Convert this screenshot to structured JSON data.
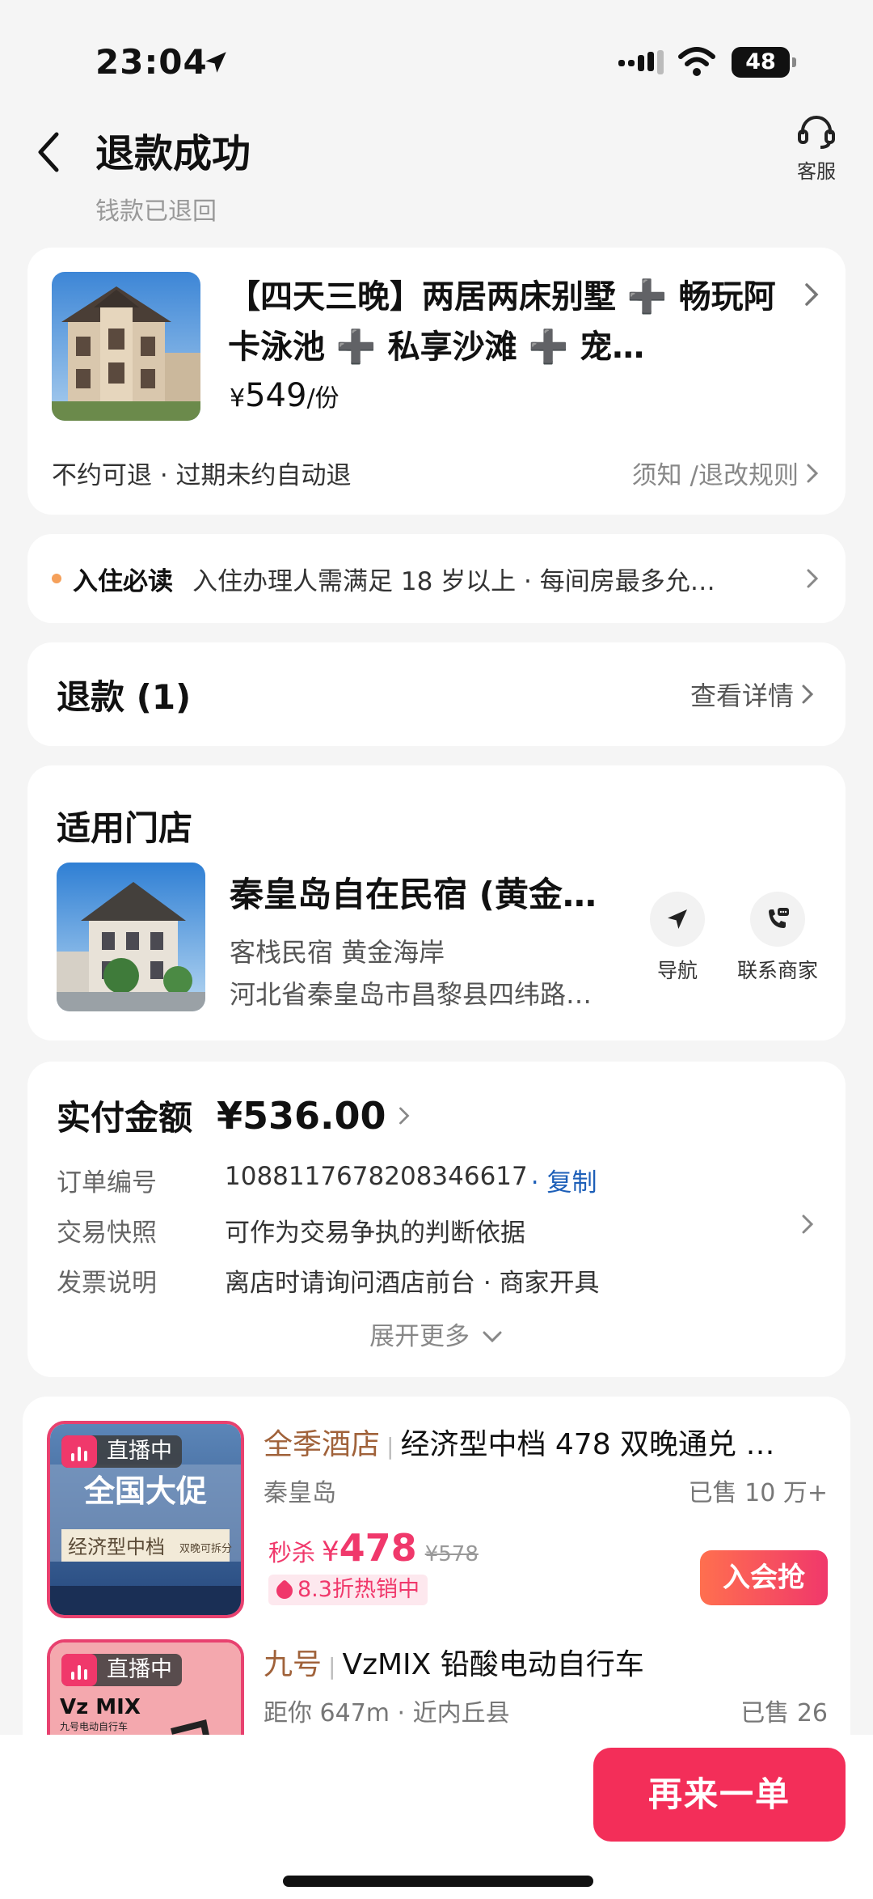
{
  "status_bar": {
    "time": "23:04",
    "battery": "48"
  },
  "header": {
    "title": "退款成功",
    "subtitle": "钱款已退回",
    "service_label": "客服"
  },
  "product": {
    "title": "【四天三晚】两居两床别墅 ➕ 畅玩阿卡泳池 ➕ 私享沙滩 ➕ 宠…",
    "price_symbol": "¥",
    "price": "549",
    "price_unit": "/份",
    "policy": "不约可退 · 过期未约自动退",
    "rules_link": "须知 /退改规则"
  },
  "notice": {
    "label": "入住必读",
    "text": "入住办理人需满足 18 岁以上  ·  每间房最多允…"
  },
  "refund": {
    "label": "退款 (1)",
    "link": "查看详情"
  },
  "store": {
    "section_title": "适用门店",
    "name": "秦皇岛自在民宿 (黄金…",
    "tags": "客栈民宿  黄金海岸",
    "address": "河北省秦皇岛市昌黎县四纬路…",
    "nav_label": "导航",
    "contact_label": "联系商家"
  },
  "payment": {
    "label": "实付金额",
    "amount": "¥536.00",
    "rows": [
      {
        "key": "订单编号",
        "value": "1088117678208346617",
        "action": "· 复制"
      },
      {
        "key": "交易快照",
        "value": "可作为交易争执的判断依据"
      },
      {
        "key": "发票说明",
        "value": "离店时请询问酒店前台 · 商家开具"
      }
    ],
    "expand": "展开更多"
  },
  "recommendations": [
    {
      "live": "直播中",
      "brand": "全季酒店",
      "name": "经济型中档 478 双晚通兑 …",
      "location": "秦皇岛",
      "sold": "已售 10 万+",
      "price_label": "秒杀",
      "price_symbol": "¥",
      "price": "478",
      "original": "¥578",
      "discount": "8.3折热销中",
      "button": "入会抢",
      "image_text_1": "全国大促",
      "image_text_2": "经济型中档",
      "image_text_3": "双晚可拆分"
    },
    {
      "live": "直播中",
      "brand": "九号",
      "name": "VzMIX 铅酸电动自行车",
      "location": "距你 647m · 近内丘县",
      "sold": "已售 26",
      "image_text_1": "Vz MIX",
      "image_text_2": "九号电动自行车"
    }
  ],
  "bottom": {
    "reorder": "再来一单"
  }
}
